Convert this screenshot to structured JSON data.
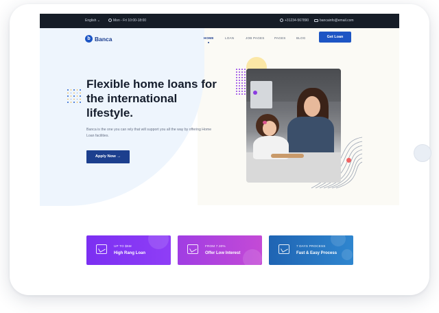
{
  "topbar": {
    "language": "English ⌄",
    "hours": "Mon - Fri 10:00-18:00",
    "phone": "+31234-567890",
    "email": "bancainfo@email.com"
  },
  "brand": {
    "mark": "b",
    "name": "Banca"
  },
  "nav": {
    "items": [
      "HOME",
      "LOAN",
      "JOB PAGES",
      "PAGES",
      "BLOG"
    ],
    "cta": "Get Loan"
  },
  "hero": {
    "title": "Flexible home loans for the international lifestyle.",
    "description": "Banca is the one you can rely that will support you all the way by offering Home Loan facilities.",
    "button": "Apply Now →"
  },
  "cards": [
    {
      "small": "UP TO $5M",
      "big": "High Rang Loan",
      "color_from": "#7b2ff2",
      "color_to": "#8f3ef6",
      "icon": "money-hand-icon"
    },
    {
      "small": "FROM 7.30%",
      "big": "Offer Low Interest",
      "color_from": "#a03de3",
      "color_to": "#c44ad6",
      "icon": "percent-icon"
    },
    {
      "small": "7 DAYS PROCESS",
      "big": "Fast & Easy Process",
      "color_from": "#1f64b3",
      "color_to": "#2f86cf",
      "icon": "handshake-icon"
    }
  ],
  "colors": {
    "topbar": "#161d27",
    "primary": "#1d55c4",
    "navy": "#1c3f8e"
  }
}
